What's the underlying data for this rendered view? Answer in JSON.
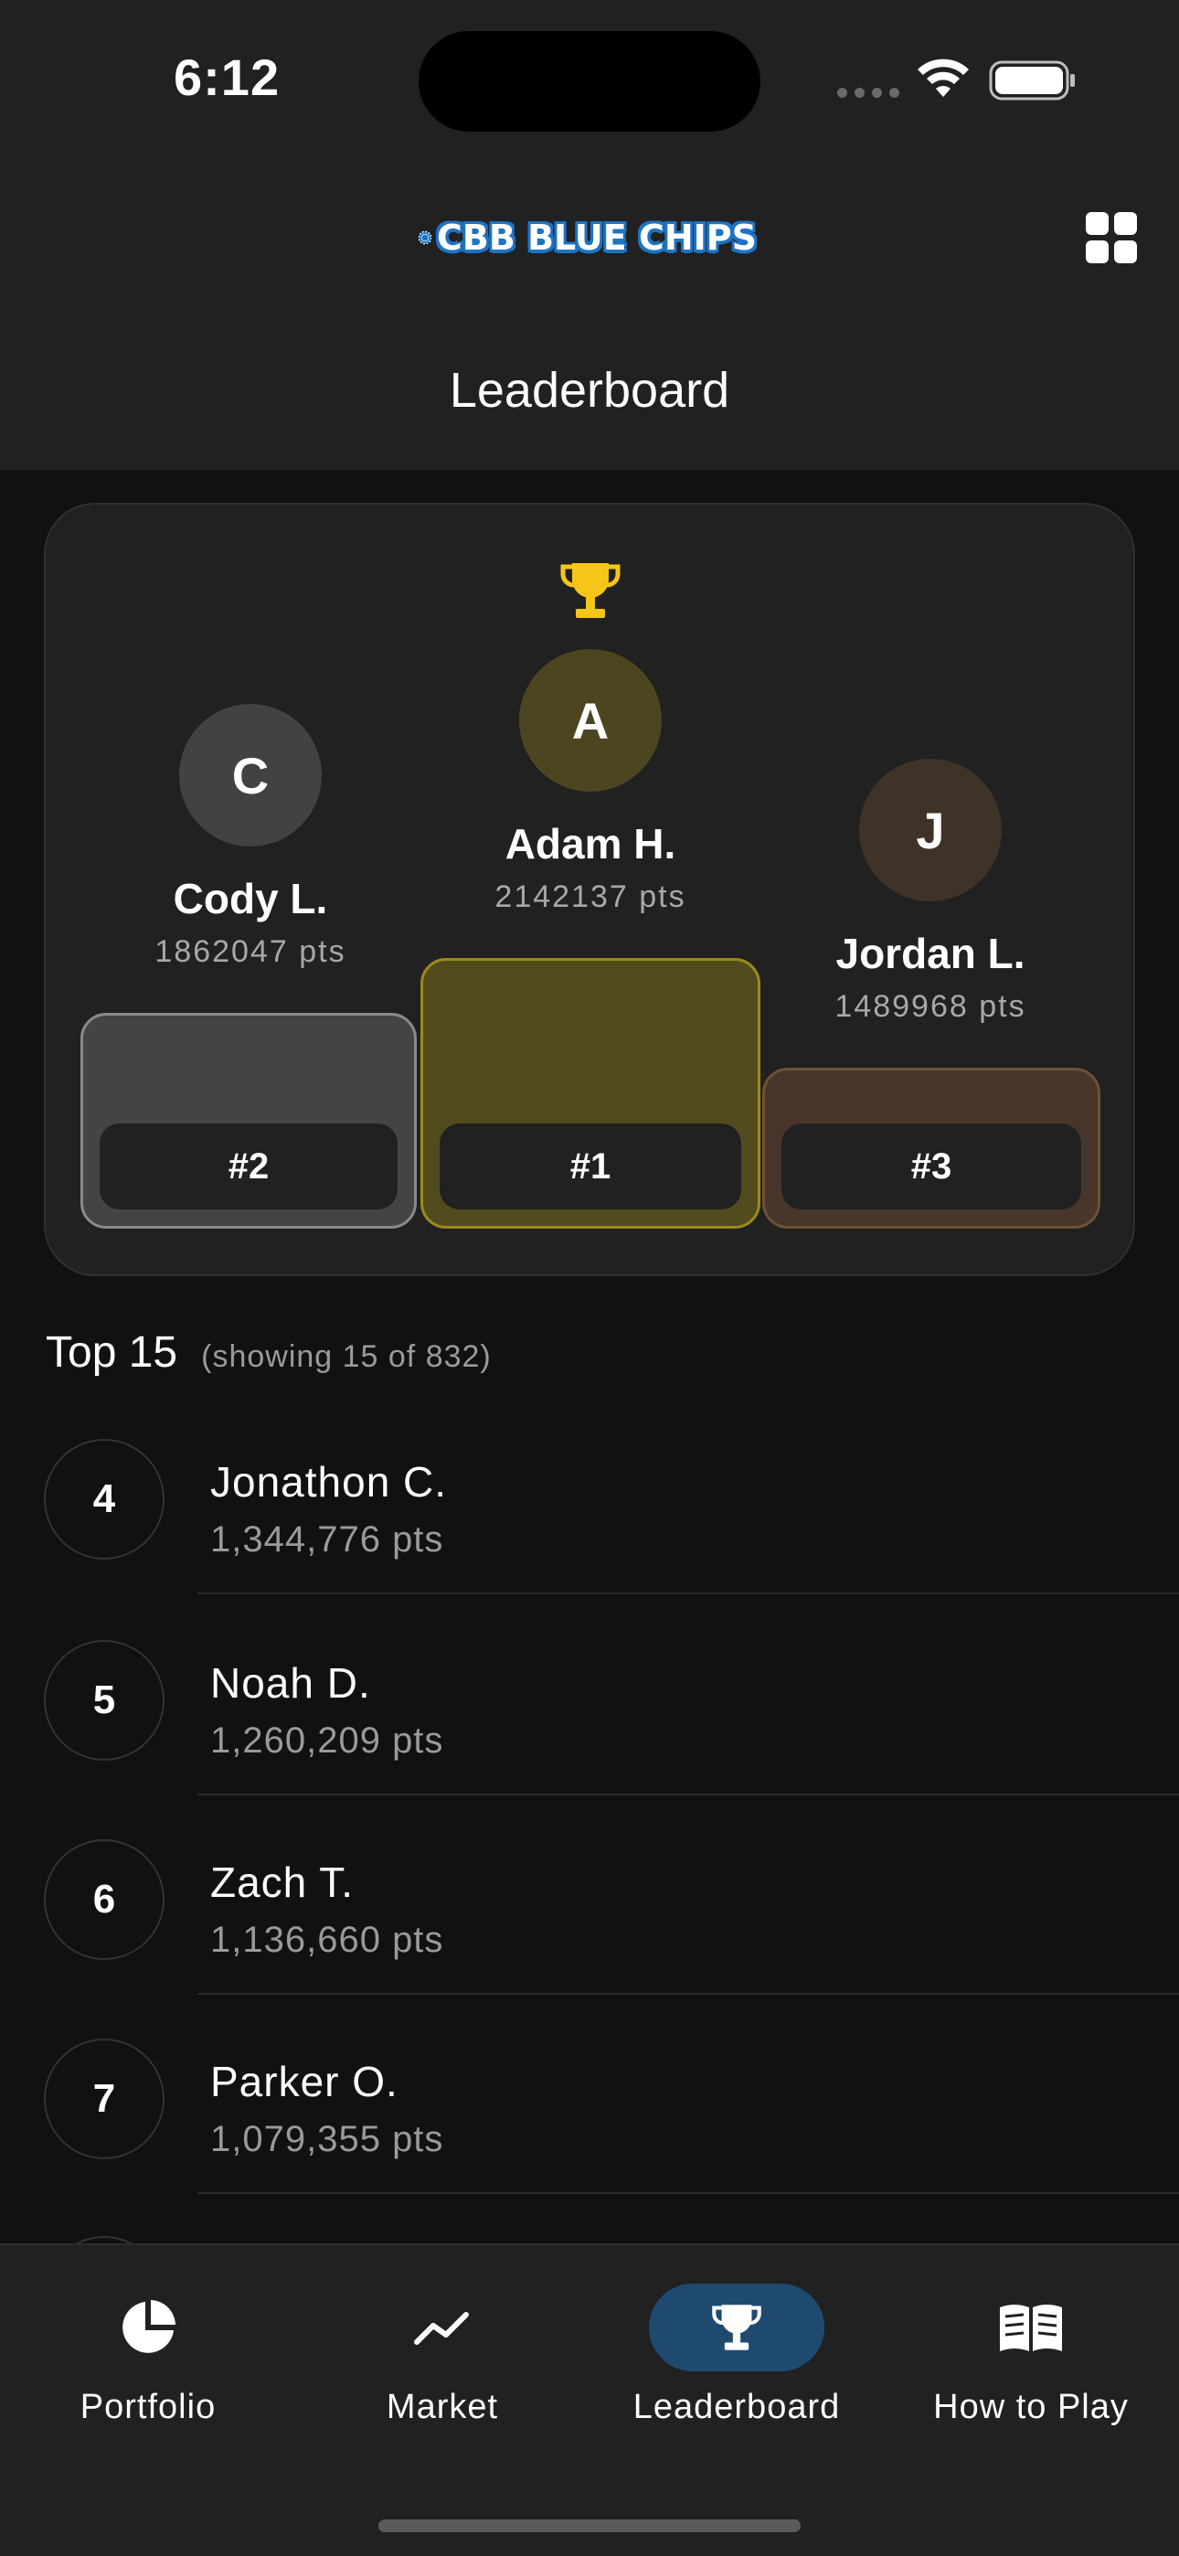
{
  "status_bar": {
    "time": "6:12"
  },
  "header": {
    "logo_text": "CBB BLUE CHIPS",
    "title": "Leaderboard"
  },
  "podium": [
    {
      "rank": "#2",
      "initial": "C",
      "name": "Cody L.",
      "pts": "1862047 pts"
    },
    {
      "rank": "#1",
      "initial": "A",
      "name": "Adam H.",
      "pts": "2142137 pts"
    },
    {
      "rank": "#3",
      "initial": "J",
      "name": "Jordan L.",
      "pts": "1489968 pts"
    }
  ],
  "list": {
    "title": "Top 15",
    "subtitle": "(showing 15 of 832)",
    "rows": [
      {
        "rank": "4",
        "name": "Jonathon C.",
        "pts": "1,344,776 pts"
      },
      {
        "rank": "5",
        "name": "Noah D.",
        "pts": "1,260,209 pts"
      },
      {
        "rank": "6",
        "name": "Zach T.",
        "pts": "1,136,660 pts"
      },
      {
        "rank": "7",
        "name": "Parker O.",
        "pts": "1,079,355 pts"
      }
    ]
  },
  "tabs": [
    {
      "label": "Portfolio",
      "icon": "pie-chart-icon",
      "active": false
    },
    {
      "label": "Market",
      "icon": "trend-line-icon",
      "active": false
    },
    {
      "label": "Leaderboard",
      "icon": "trophy-icon",
      "active": true
    },
    {
      "label": "How to Play",
      "icon": "book-icon",
      "active": false
    }
  ],
  "colors": {
    "gold": "#f5c518",
    "first_block": "#524b1d",
    "second_block": "#444444",
    "third_block": "#473629",
    "active_tab": "#1f4a70"
  }
}
